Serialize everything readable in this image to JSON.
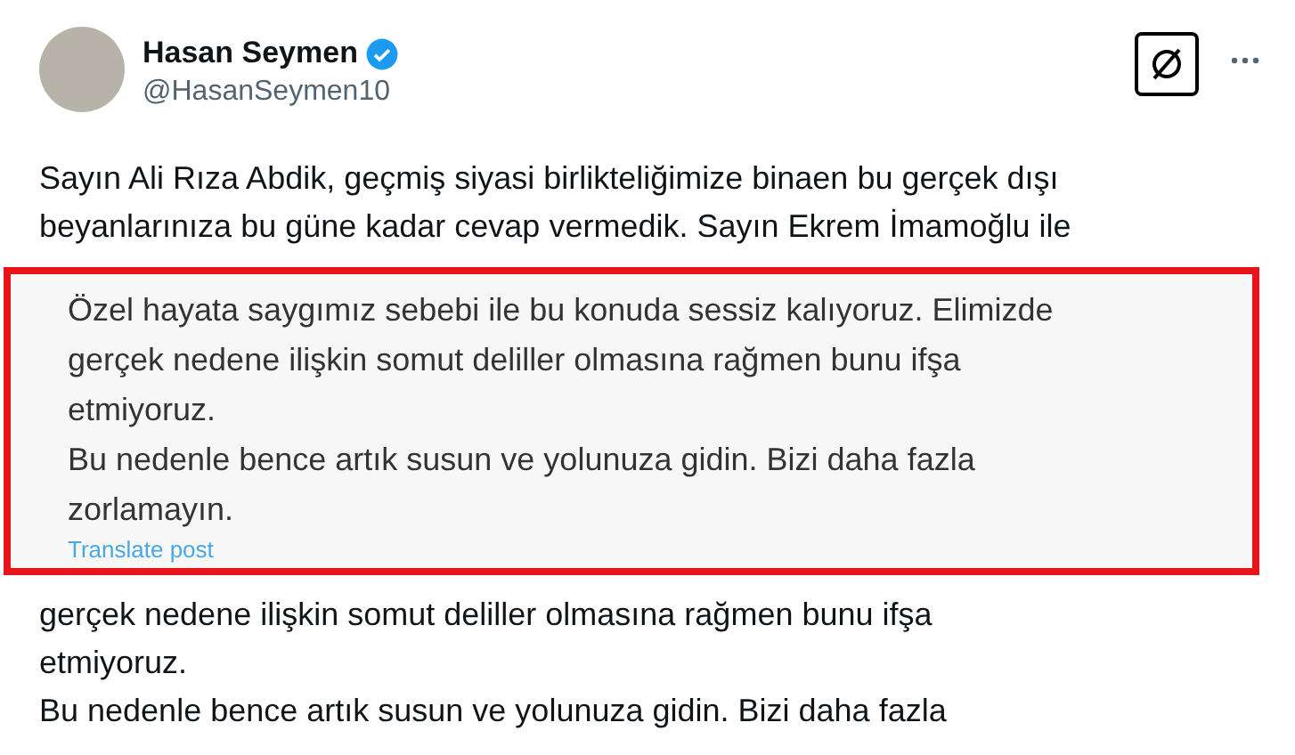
{
  "post": {
    "author": {
      "name": "Hasan Seymen",
      "handle": "@HasanSeymen10",
      "verified": true
    },
    "body_lines_top": [
      "Sayın Ali Rıza Abdik, geçmiş siyasi birlikteliğimize binaen bu gerçek dışı",
      "beyanlarınıza bu güne kadar cevap vermedik. Sayın Ekrem İmamoğlu ile"
    ],
    "body_lines_bottom": [
      "gerçek nedene ilişkin somut deliller olmasına rağmen bunu ifşa",
      "etmiyoruz.",
      "Bu nedenle bence artık susun ve yolunuza gidin. Bizi daha fazla"
    ]
  },
  "highlight": {
    "lines": [
      "Özel hayata saygımız sebebi ile bu konuda sessiz kalıyoruz. Elimizde",
      "gerçek nedene ilişkin somut deliller olmasına rağmen bunu ifşa",
      "etmiyoruz.",
      "Bu nedenle bence artık susun ve yolunuza gidin. Bizi daha fazla",
      "zorlamayın."
    ],
    "translate_link": "Translate post"
  }
}
